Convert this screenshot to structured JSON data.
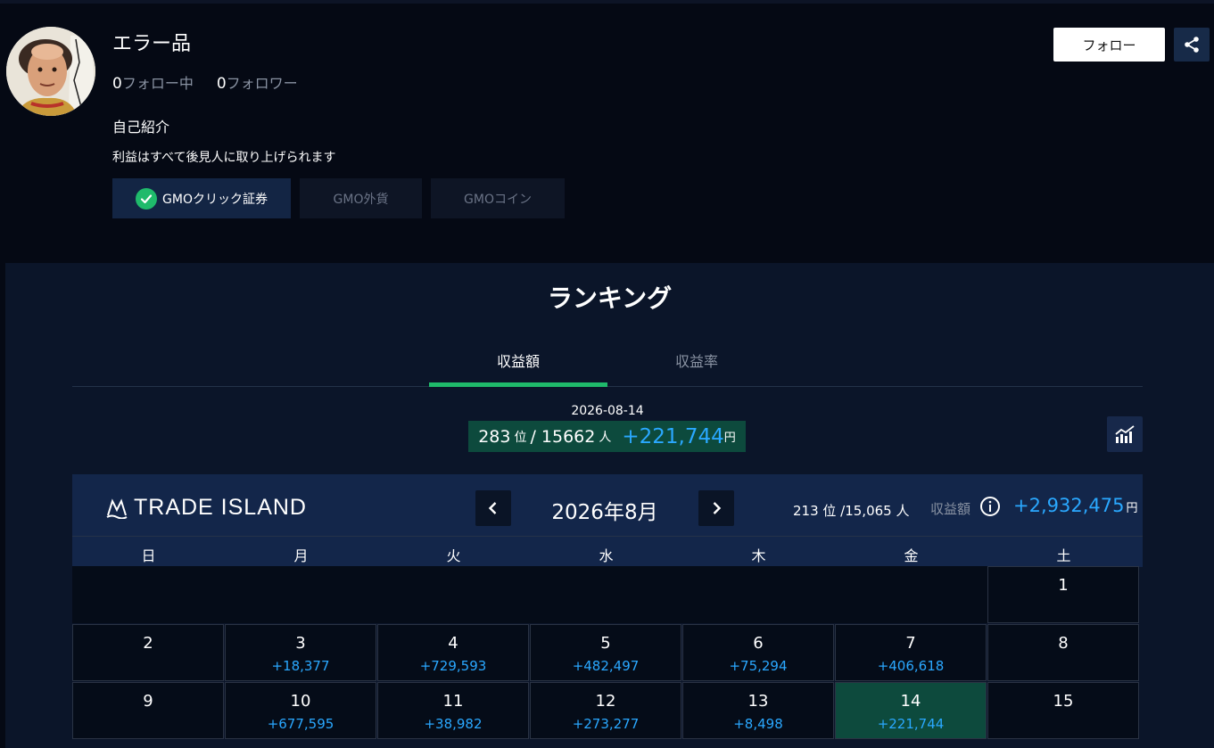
{
  "profile": {
    "name": "エラー品",
    "following_count": "0",
    "following_label": "フォロー中",
    "followers_count": "0",
    "followers_label": "フォロワー",
    "bio_label": "自己紹介",
    "bio_text": "利益はすべて後見人に取り上げられます",
    "follow_button": "フォロー",
    "brokers": [
      "GMOクリック証券",
      "GMO外貨",
      "GMOコイン"
    ]
  },
  "ranking": {
    "title": "ランキング",
    "tabs": [
      "収益額",
      "収益率"
    ],
    "active_tab": "収益額",
    "date": "2026-08-14",
    "rank": "283",
    "rank_unit": "位",
    "sep": "/",
    "total": "15662",
    "total_unit": "人",
    "profit": "+221,744",
    "yen": "円"
  },
  "calendar": {
    "logo": "TRADE ISLAND",
    "month": "2026年8月",
    "month_rank": "213 位 /15,065 人",
    "profit_label": "収益額",
    "month_profit": "+2,932,475",
    "yen": "円",
    "weekdays": [
      "日",
      "月",
      "火",
      "水",
      "木",
      "金",
      "土"
    ],
    "weeks": [
      [
        {
          "day": "",
          "pl": ""
        },
        {
          "day": "",
          "pl": ""
        },
        {
          "day": "",
          "pl": ""
        },
        {
          "day": "",
          "pl": ""
        },
        {
          "day": "",
          "pl": ""
        },
        {
          "day": "",
          "pl": ""
        },
        {
          "day": "1",
          "pl": ""
        }
      ],
      [
        {
          "day": "2",
          "pl": ""
        },
        {
          "day": "3",
          "pl": "+18,377"
        },
        {
          "day": "4",
          "pl": "+729,593"
        },
        {
          "day": "5",
          "pl": "+482,497"
        },
        {
          "day": "6",
          "pl": "+75,294"
        },
        {
          "day": "7",
          "pl": "+406,618"
        },
        {
          "day": "8",
          "pl": ""
        }
      ],
      [
        {
          "day": "9",
          "pl": ""
        },
        {
          "day": "10",
          "pl": "+677,595"
        },
        {
          "day": "11",
          "pl": "+38,982"
        },
        {
          "day": "12",
          "pl": "+273,277"
        },
        {
          "day": "13",
          "pl": "+8,498"
        },
        {
          "day": "14",
          "pl": "+221,744"
        },
        {
          "day": "15",
          "pl": ""
        }
      ]
    ],
    "highlight_day": "14"
  },
  "colors": {
    "accent_green": "#1fba6b",
    "profit_blue": "#2aa8ff",
    "highlight": "#0d4a3d"
  }
}
